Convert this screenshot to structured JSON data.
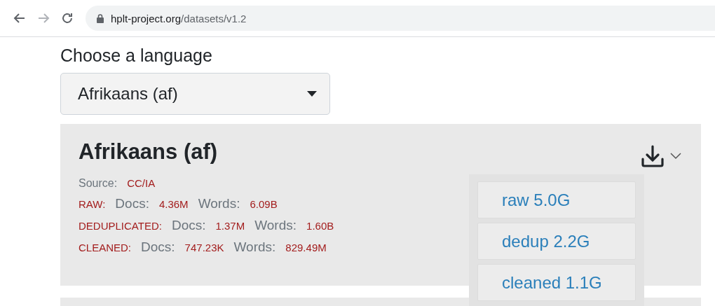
{
  "browser": {
    "url_domain": "hplt-project.org",
    "url_path": "/datasets/v1.2"
  },
  "language_picker": {
    "label": "Choose a language",
    "value": "Afrikaans (af)"
  },
  "dataset_card": {
    "title": "Afrikaans (af)",
    "source": {
      "label": "Source:",
      "value": "CC/IA"
    },
    "stats": [
      {
        "label": "RAW:",
        "docs_label": "Docs:",
        "docs": "4.36M",
        "words_label": "Words:",
        "words": "6.09B"
      },
      {
        "label": "DEDUPLICATED:",
        "docs_label": "Docs:",
        "docs": "1.37M",
        "words_label": "Words:",
        "words": "1.60B"
      },
      {
        "label": "CLEANED:",
        "docs_label": "Docs:",
        "docs": "747.23K",
        "words_label": "Words:",
        "words": "829.49M"
      }
    ],
    "download_menu": {
      "expanded": true,
      "items": [
        "raw 5.0G",
        "dedup 2.2G",
        "cleaned 1.1G"
      ]
    }
  }
}
